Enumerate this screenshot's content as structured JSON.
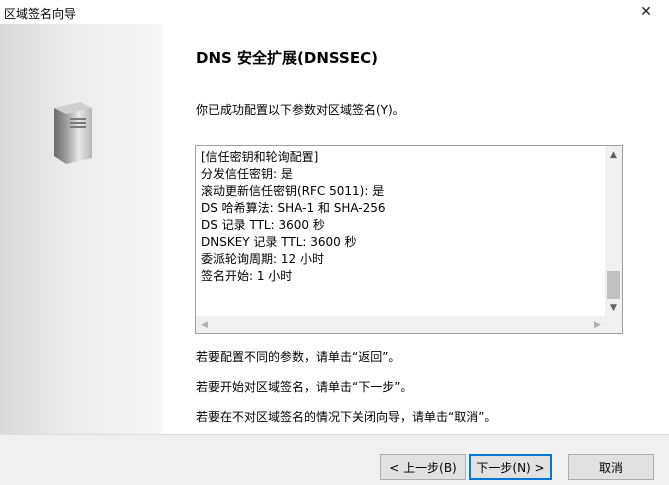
{
  "window": {
    "title": "区域签名向导",
    "close_glyph": "✕"
  },
  "page": {
    "heading": "DNS 安全扩展(DNSSEC)",
    "intro": "你已成功配置以下参数对区域签名(Y)。"
  },
  "summary_lines": [
    "[信任密钥和轮询配置]",
    "分发信任密钥: 是",
    "滚动更新信任密钥(RFC 5011): 是",
    "DS 哈希算法: SHA-1 和 SHA-256",
    "DS 记录 TTL: 3600 秒",
    "DNSKEY 记录 TTL: 3600 秒",
    "委派轮询周期: 12 小时",
    "签名开始: 1 小时"
  ],
  "notes": {
    "back": "若要配置不同的参数，请单击“返回”。",
    "next": "若要开始对区域签名，请单击“下一步”。",
    "cancel": "若要在不对区域签名的情况下关闭向导，请单击“取消”。"
  },
  "buttons": {
    "back": "< 上一步(B)",
    "next": "下一步(N) >",
    "cancel": "取消"
  },
  "icons": {
    "server": "server-icon",
    "scroll_up": "chevron-up-icon",
    "scroll_down": "chevron-down-icon",
    "scroll_left": "chevron-left-icon",
    "scroll_right": "chevron-right-icon"
  },
  "colors": {
    "default_button_border": "#0078d7",
    "footer_bg": "#f0f0f0"
  }
}
